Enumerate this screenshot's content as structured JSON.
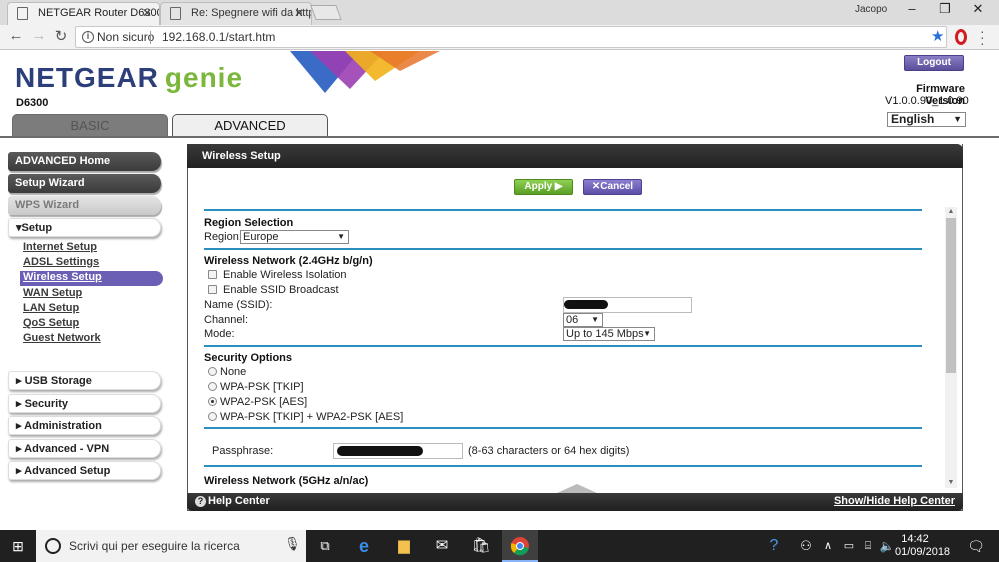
{
  "browser": {
    "tabs": [
      {
        "title": "NETGEAR Router D6300",
        "active": true
      },
      {
        "title": "Re: Spegnere wifi da http",
        "active": false
      }
    ],
    "user": "Jacopo",
    "security_label": "Non sicuro",
    "url": "192.168.0.1/start.htm"
  },
  "header": {
    "logo_main": "NETGEAR",
    "logo_genie": "genie",
    "model": "D6300",
    "logout_label": "Logout",
    "firmware_label": "Firmware Version",
    "firmware_value": "V1.0.0.90_1.0.90",
    "language": "English",
    "tabs": {
      "basic": "BASIC",
      "advanced": "ADVANCED"
    }
  },
  "sidebar": {
    "advanced_home": "ADVANCED Home",
    "setup_wizard": "Setup Wizard",
    "wps_wizard": "WPS Wizard",
    "setup": "Setup",
    "setup_items": [
      "Internet Setup",
      "ADSL Settings",
      "Wireless Setup",
      "WAN Setup",
      "LAN Setup",
      "QoS Setup",
      "Guest Network"
    ],
    "active_item": "Wireless Setup",
    "groups": [
      "USB Storage",
      "Security",
      "Administration",
      "Advanced - VPN",
      "Advanced Setup"
    ]
  },
  "panel": {
    "title": "Wireless Setup",
    "apply_label": "Apply ▶",
    "cancel_label": "Cancel",
    "region": {
      "heading": "Region Selection",
      "label": "Region:",
      "value": "Europe"
    },
    "wireless24": {
      "heading": "Wireless Network (2.4GHz b/g/n)",
      "isolation_label": "Enable Wireless Isolation",
      "isolation_checked": false,
      "broadcast_label": "Enable SSID Broadcast",
      "broadcast_checked": false,
      "ssid_label": "Name (SSID):",
      "channel_label": "Channel:",
      "channel_value": "06",
      "mode_label": "Mode:",
      "mode_value": "Up to 145 Mbps"
    },
    "security": {
      "heading": "Security Options",
      "options": [
        "None",
        "WPA-PSK [TKIP]",
        "WPA2-PSK [AES]",
        "WPA-PSK [TKIP] + WPA2-PSK [AES]"
      ],
      "selected": "WPA2-PSK [AES]",
      "passphrase_label": "Passphrase:",
      "passphrase_hint": "(8-63 characters or 64 hex digits)"
    },
    "wireless5_heading": "Wireless Network (5GHz a/n/ac)",
    "help_center": "Help Center",
    "show_hide": "Show/Hide Help Center"
  },
  "taskbar": {
    "search_placeholder": "Scrivi qui per eseguire la ricerca",
    "time": "14:42",
    "date": "01/09/2018"
  },
  "colors": {
    "netgear_blue": "#2c3f7a",
    "genie_green": "#7ab73b",
    "accent_purple": "#6b5fb5",
    "apply_green": "#6db02f",
    "rule_blue": "#2a8fbd"
  }
}
